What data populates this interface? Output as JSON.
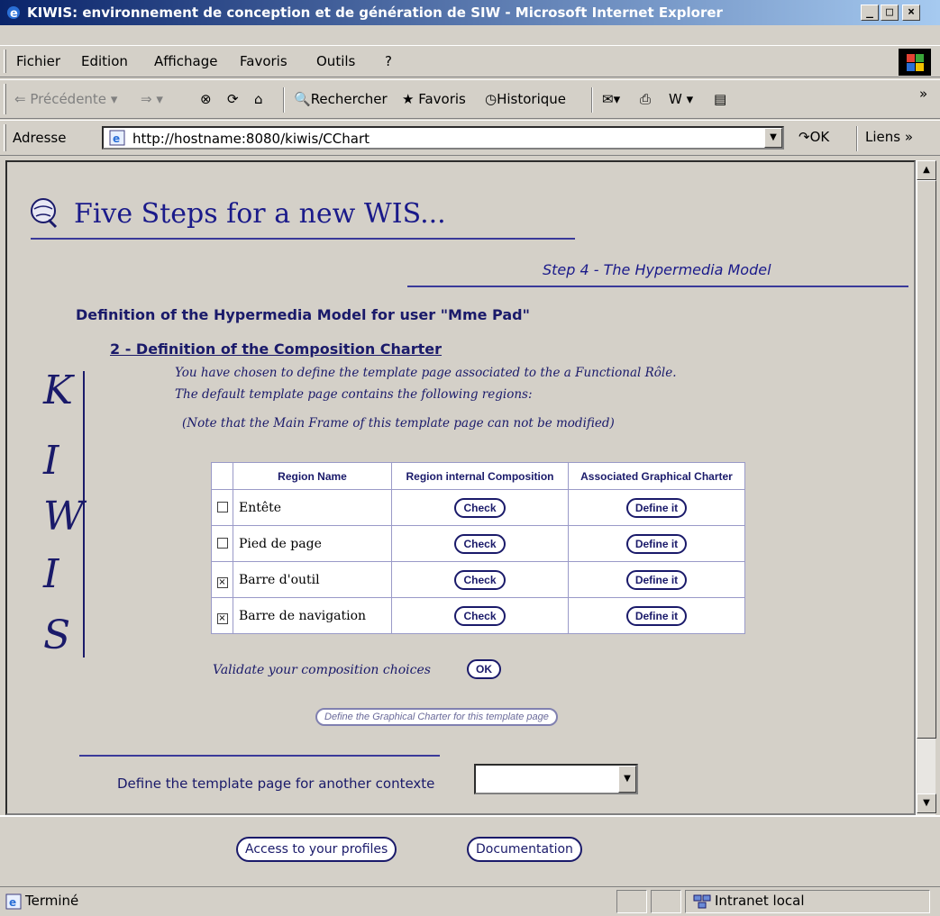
{
  "window": {
    "title": "KIWIS: environnement de conception et de génération de SIW - Microsoft Internet Explorer",
    "controls": {
      "minimize": "_",
      "maximize": "□",
      "close": "×"
    }
  },
  "menu": [
    "Fichier",
    "Edition",
    "Affichage",
    "Favoris",
    "Outils",
    "?"
  ],
  "toolbar": {
    "back": "Précédente",
    "search": "Rechercher",
    "favorites": "Favoris",
    "history": "Historique"
  },
  "address": {
    "label": "Adresse",
    "url": "http://hostname:8080/kiwis/CChart",
    "go": "OK",
    "links": "Liens"
  },
  "page": {
    "title": "Five Steps for a new WIS...",
    "step": "Step 4 - The Hypermedia Model",
    "definition_heading": "Definition of the Hypermedia Model for user \"Mme Pad\"",
    "composition_heading": "2 - Definition of the Composition Charter",
    "para1": "You have chosen to define the template page associated to the a Functional Rôle.",
    "para2": "The default template page contains the following regions:",
    "note": "(Note that the Main Frame of this template page can not be modified)",
    "kiwis_letters": [
      "K",
      "I",
      "W",
      "I",
      "S"
    ],
    "table": {
      "headers": [
        "Region Name",
        "Region internal Composition",
        "Associated Graphical Charter"
      ],
      "rows": [
        {
          "checked": false,
          "name": "Entête",
          "check": "Check",
          "define": "Define it"
        },
        {
          "checked": false,
          "name": "Pied de page",
          "check": "Check",
          "define": "Define it"
        },
        {
          "checked": true,
          "name": "Barre d'outil",
          "check": "Check",
          "define": "Define it"
        },
        {
          "checked": true,
          "name": "Barre de navigation",
          "check": "Check",
          "define": "Define it"
        }
      ]
    },
    "validate_label": "Validate your composition choices",
    "ok_button": "OK",
    "charter_button": "Define the Graphical Charter for this template page",
    "another_context_label": "Define the template page for another contexte",
    "context_select_value": ""
  },
  "bottom": {
    "profiles_button": "Access to your profiles",
    "documentation_button": "Documentation"
  },
  "status": {
    "text": "Terminé",
    "zone": "Intranet local"
  }
}
